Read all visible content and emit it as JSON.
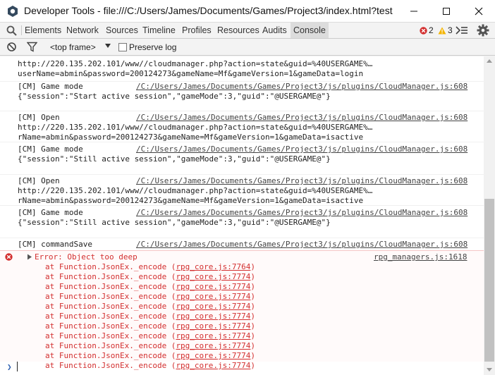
{
  "window": {
    "title": "Developer Tools - file:///C:/Users/James/Documents/Games/Project3/index.html?test"
  },
  "tabs": [
    {
      "label": "Elements",
      "active": false
    },
    {
      "label": "Network",
      "active": false
    },
    {
      "label": "Sources",
      "active": false
    },
    {
      "label": "Timeline",
      "active": false
    },
    {
      "label": "Profiles",
      "active": false
    },
    {
      "label": "Resources",
      "active": false
    },
    {
      "label": "Audits",
      "active": false
    },
    {
      "label": "Console",
      "active": true
    }
  ],
  "status": {
    "errors": "2",
    "warnings": "3"
  },
  "filter": {
    "context": "<top frame>",
    "preserve_log_label": "Preserve log"
  },
  "messages": [
    {
      "lines": [
        "http://220.135.202.101/www//cloudmanager.php?action=state&guid=%40USERGAME%…",
        "userName=abmin&password=200124273&gameName=Mf&gameVersion=1&gameData=login"
      ]
    },
    {
      "lines": [
        "[CM] Game mode",
        "{\"session\":\"Start active session\",\"gameMode\":3,\"guid\":\"@USERGAME@\"}"
      ],
      "source": "/C:/Users/James/Documents/Games/Project3/js/plugins/CloudManager.js:608"
    },
    {
      "lines": [
        "[CM] Open",
        "http://220.135.202.101/www//cloudmanager.php?action=state&guid=%40USERGAME%…",
        "rName=abmin&password=200124273&gameName=Mf&gameVersion=1&gameData=isactive"
      ],
      "source": "/C:/Users/James/Documents/Games/Project3/js/plugins/CloudManager.js:608"
    },
    {
      "lines": [
        "[CM] Game mode",
        "{\"session\":\"Still active session\",\"gameMode\":3,\"guid\":\"@USERGAME@\"}"
      ],
      "source": "/C:/Users/James/Documents/Games/Project3/js/plugins/CloudManager.js:608"
    },
    {
      "lines": [
        "[CM] Open",
        "http://220.135.202.101/www//cloudmanager.php?action=state&guid=%40USERGAME%…",
        "rName=abmin&password=200124273&gameName=Mf&gameVersion=1&gameData=isactive"
      ],
      "source": "/C:/Users/James/Documents/Games/Project3/js/plugins/CloudManager.js:608"
    },
    {
      "lines": [
        "[CM] Game mode",
        "{\"session\":\"Still active session\",\"gameMode\":3,\"guid\":\"@USERGAME@\"}"
      ],
      "source": "/C:/Users/James/Documents/Games/Project3/js/plugins/CloudManager.js:608"
    },
    {
      "lines": [
        "[CM] commandSave"
      ],
      "source": "/C:/Users/James/Documents/Games/Project3/js/plugins/CloudManager.js:608"
    }
  ],
  "error": {
    "message": "Error: Object too deep",
    "source": "rpg_managers.js:1618",
    "trace_prefix": "at Function.JsonEx._encode (",
    "trace_suffix": ")",
    "trace": [
      "rpg_core.js:7764",
      "rpg_core.js:7774",
      "rpg_core.js:7774",
      "rpg_core.js:7774",
      "rpg_core.js:7774",
      "rpg_core.js:7774",
      "rpg_core.js:7774",
      "rpg_core.js:7774",
      "rpg_core.js:7774",
      "rpg_core.js:7774",
      "rpg_core.js:7774"
    ]
  },
  "colors": {
    "error": "#d32f2f",
    "warning": "#f4b400",
    "accent": "#2a5db0"
  }
}
